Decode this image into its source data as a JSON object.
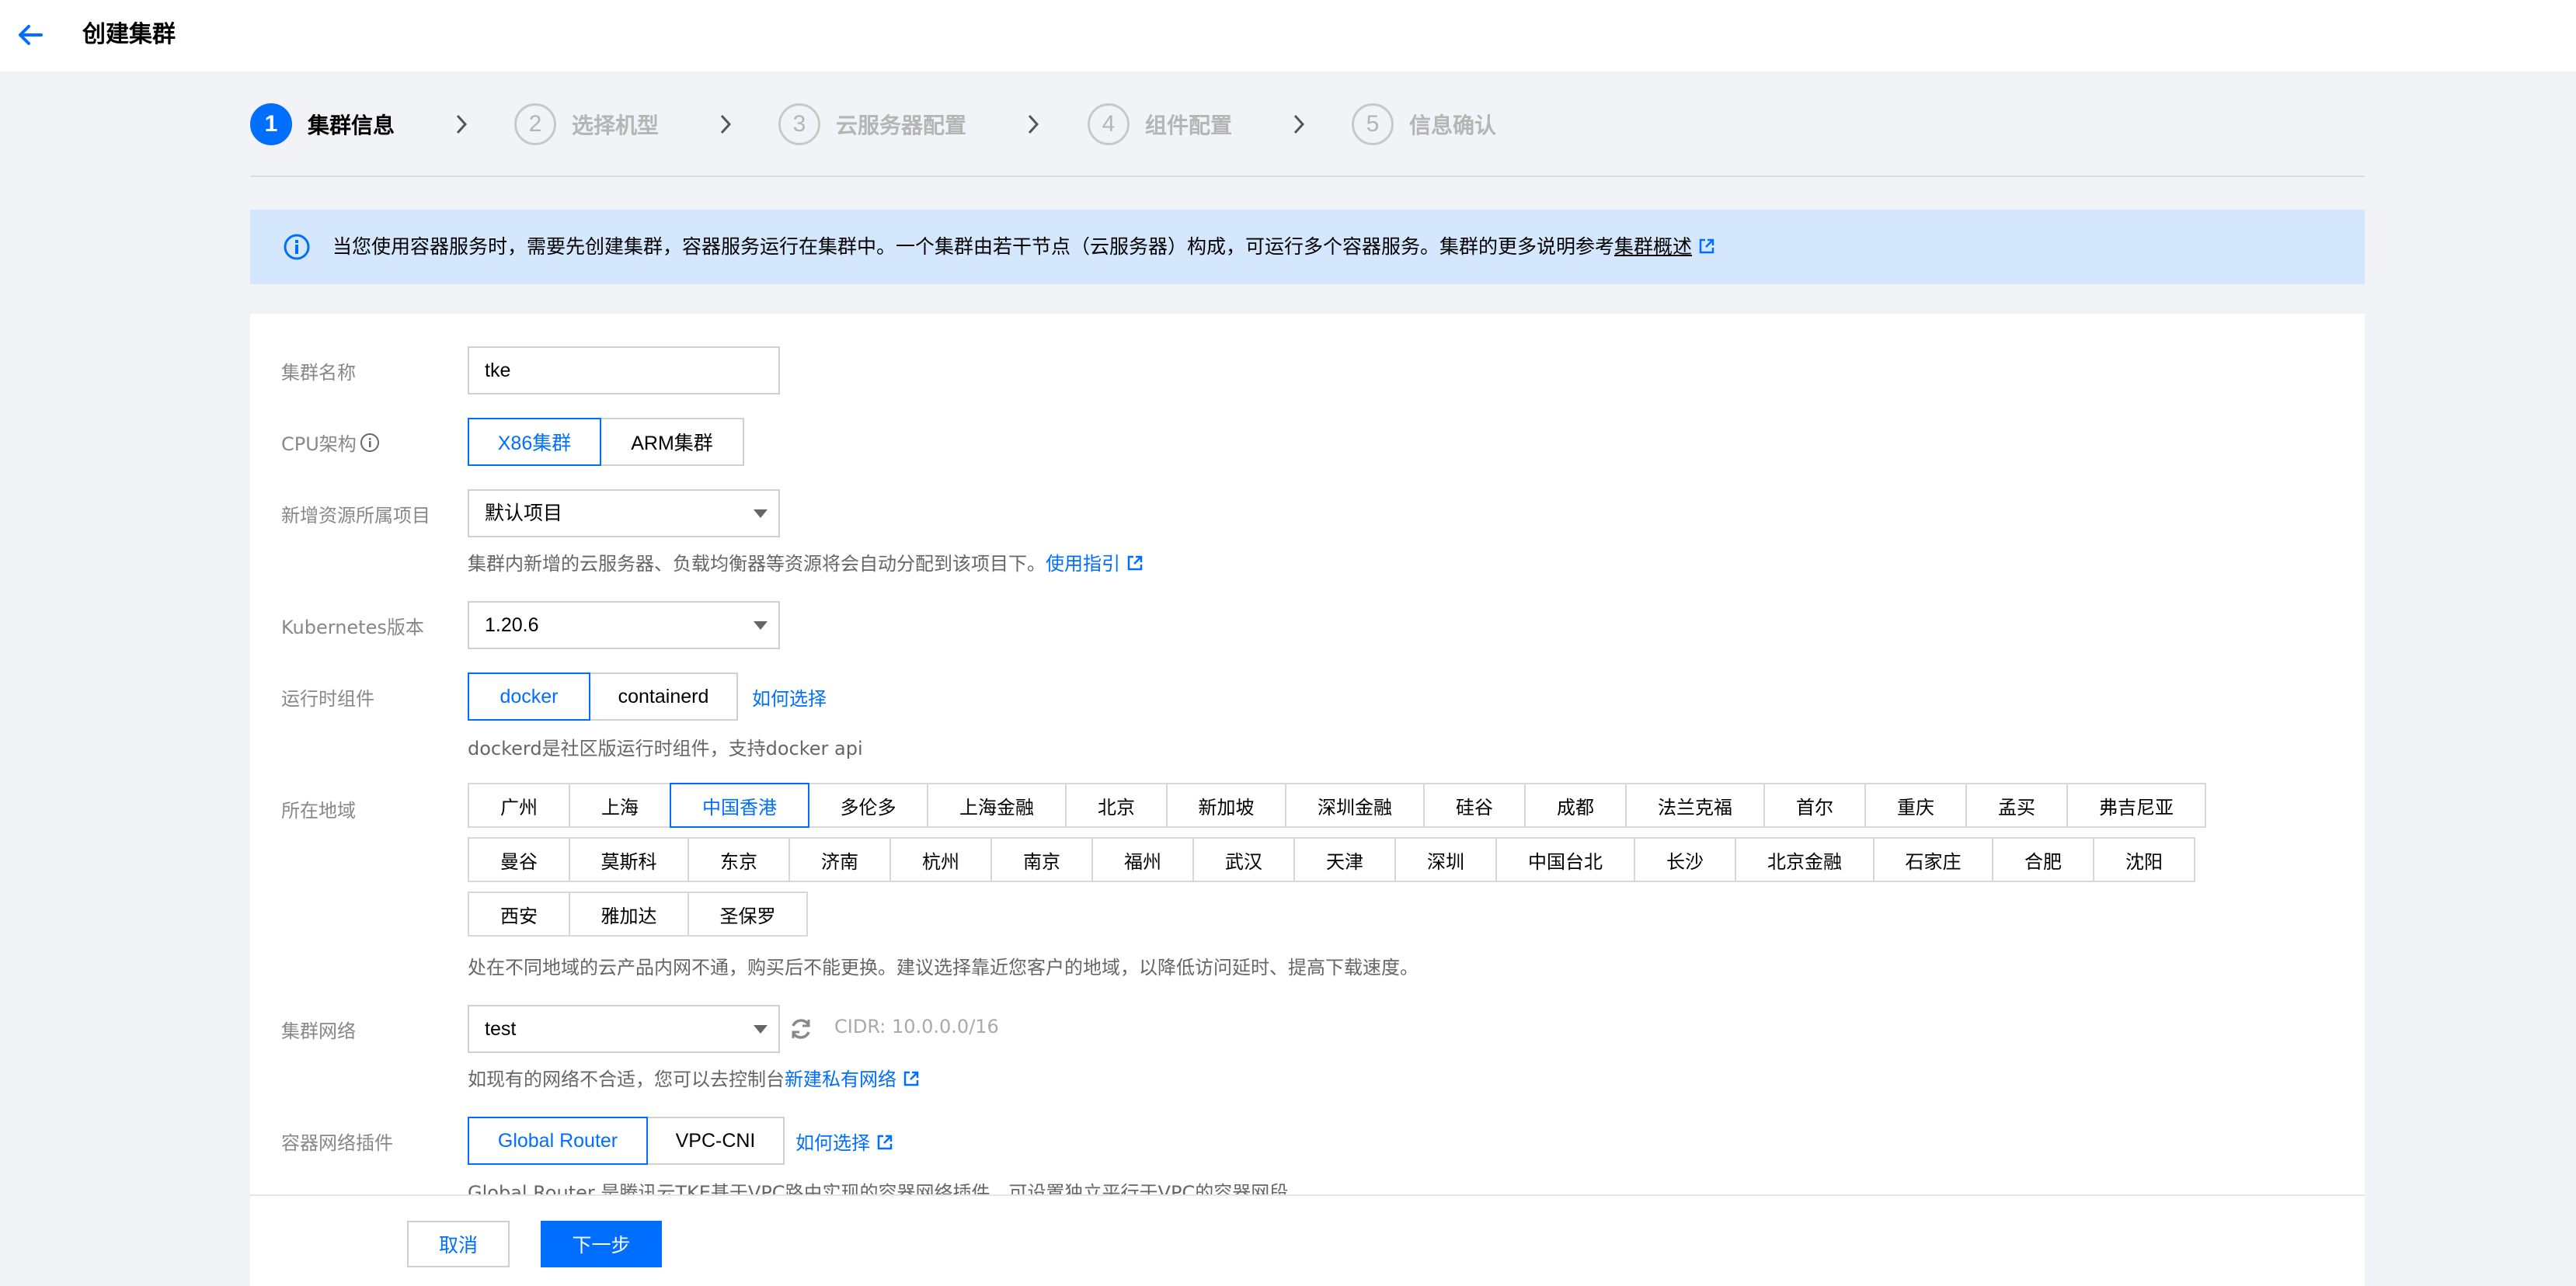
{
  "header": {
    "title": "创建集群"
  },
  "steps": [
    {
      "num": "1",
      "label": "集群信息"
    },
    {
      "num": "2",
      "label": "选择机型"
    },
    {
      "num": "3",
      "label": "云服务器配置"
    },
    {
      "num": "4",
      "label": "组件配置"
    },
    {
      "num": "5",
      "label": "信息确认"
    }
  ],
  "notice": {
    "text": "当您使用容器服务时，需要先创建集群，容器服务运行在集群中。一个集群由若干节点（云服务器）构成，可运行多个容器服务。集群的更多说明参考",
    "link": "集群概述"
  },
  "form": {
    "cluster_name": {
      "label": "集群名称",
      "value": "tke"
    },
    "cpu_arch": {
      "label": "CPU架构",
      "options": [
        "X86集群",
        "ARM集群"
      ],
      "selected": "X86集群"
    },
    "project": {
      "label": "新增资源所属项目",
      "value": "默认项目",
      "help": "集群内新增的云服务器、负载均衡器等资源将会自动分配到该项目下。",
      "help_link": "使用指引"
    },
    "k8s_version": {
      "label": "Kubernetes版本",
      "value": "1.20.6"
    },
    "runtime": {
      "label": "运行时组件",
      "options": [
        "docker",
        "containerd"
      ],
      "selected": "docker",
      "link": "如何选择",
      "help": "dockerd是社区版运行时组件，支持docker api"
    },
    "region": {
      "label": "所在地域",
      "selected": "中国香港",
      "rows": [
        [
          "广州",
          "上海",
          "中国香港",
          "多伦多",
          "上海金融",
          "北京",
          "新加坡",
          "深圳金融",
          "硅谷",
          "成都",
          "法兰克福",
          "首尔",
          "重庆",
          "孟买",
          "弗吉尼亚"
        ],
        [
          "曼谷",
          "莫斯科",
          "东京",
          "济南",
          "杭州",
          "南京",
          "福州",
          "武汉",
          "天津",
          "深圳",
          "中国台北",
          "长沙",
          "北京金融",
          "石家庄",
          "合肥",
          "沈阳"
        ],
        [
          "西安",
          "雅加达",
          "圣保罗"
        ]
      ],
      "help": "处在不同地域的云产品内网不通，购买后不能更换。建议选择靠近您客户的地域，以降低访问延时、提高下载速度。"
    },
    "network": {
      "label": "集群网络",
      "value": "test",
      "cidr": "CIDR: 10.0.0.0/16",
      "help": "如现有的网络不合适，您可以去控制台",
      "help_link": "新建私有网络"
    },
    "cni": {
      "label": "容器网络插件",
      "options": [
        "Global Router",
        "VPC-CNI"
      ],
      "selected": "Global Router",
      "link": "如何选择",
      "help": "Global Router 是腾讯云TKE基于VPC路由实现的容器网络插件，可设置独立平行于VPC的容器网段。"
    }
  },
  "footer": {
    "cancel": "取消",
    "next": "下一步"
  },
  "colors": {
    "primary": "#006eff",
    "banner": "#d5e7fd",
    "background": "#f2f3f7"
  }
}
